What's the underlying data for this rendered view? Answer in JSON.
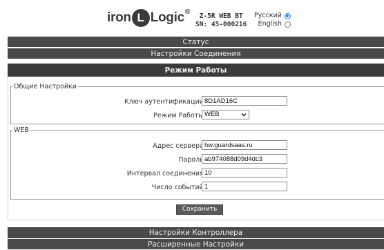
{
  "header": {
    "logo_left": "iron",
    "logo_mark": "L",
    "logo_right": "Logic",
    "logo_reg": "®",
    "device_model": "Z-5R WEB BT",
    "device_sn": "SN: 45-000216",
    "lang_ru": "Русский",
    "lang_en": "English",
    "lang_selected": "ru"
  },
  "nav": {
    "status": "Статус",
    "connection": "Настройки Соединения",
    "mode": "Режим Работы",
    "controller": "Настройки Контроллера",
    "advanced": "Расширенные Настройки"
  },
  "general": {
    "legend": "Общие Настройки",
    "auth_label": "Ключ аутентификации:",
    "auth_value": "8D1AD16C",
    "mode_label": "Режим Работы:",
    "mode_value": "WEB"
  },
  "web": {
    "legend": "WEB",
    "server_label": "Адрес сервера:",
    "server_value": "hw.guardsaas.ru",
    "password_label": "Пароль:",
    "password_value": "ab974088d09d4dc3",
    "interval_label": "Интервал соединения:",
    "interval_value": "10",
    "events_label": "Число событий:",
    "events_value": "1"
  },
  "actions": {
    "save": "Сохранить"
  },
  "colors": {
    "nav_bar": "#4a4a4a",
    "nav_active": "#3b3b3b",
    "radio_accent": "#1a73e8"
  }
}
